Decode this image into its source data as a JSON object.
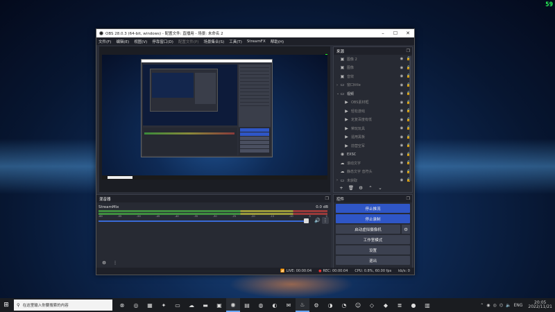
{
  "desktop": {
    "fps": "59"
  },
  "window": {
    "title": "OBS 28.0.3 (64-bit, windows) - 配置文件: 直播用 - 场景: 未命名 2",
    "min": "–",
    "max": "☐",
    "close": "✕"
  },
  "menu": [
    {
      "label": "文件(F)",
      "dim": false
    },
    {
      "label": "编辑(E)",
      "dim": false
    },
    {
      "label": "视图(V)",
      "dim": false
    },
    {
      "label": "停靠窗口(D)",
      "dim": false
    },
    {
      "label": "配置文件(P)",
      "dim": true
    },
    {
      "label": "场景集合(S)",
      "dim": false
    },
    {
      "label": "工具(T)",
      "dim": false
    },
    {
      "label": "StreamFX",
      "dim": false
    },
    {
      "label": "帮助(H)",
      "dim": false
    }
  ],
  "sources": {
    "title": "来源",
    "items": [
      {
        "label": "图像 2",
        "icon": "▣",
        "icon_name": "image-icon",
        "child": false,
        "chev": "",
        "dim": true
      },
      {
        "label": "图像",
        "icon": "▣",
        "icon_name": "image-icon",
        "child": false,
        "chev": "",
        "dim": true
      },
      {
        "label": "音效",
        "icon": "▣",
        "icon_name": "image-icon",
        "child": false,
        "chev": "",
        "dim": true
      },
      {
        "label": "窗口title",
        "icon": "▭",
        "icon_name": "folder-icon",
        "child": false,
        "chev": "›",
        "dim": true
      },
      {
        "label": "视频",
        "icon": "▭",
        "icon_name": "folder-icon",
        "child": false,
        "chev": "⌄",
        "dim": false
      },
      {
        "label": "OBS素材框",
        "icon": "▶",
        "icon_name": "media-icon",
        "child": true,
        "chev": "",
        "dim": true
      },
      {
        "label": "轻松游戏",
        "icon": "▶",
        "icon_name": "media-icon",
        "child": true,
        "chev": "",
        "dim": true
      },
      {
        "label": "定复百度有低",
        "icon": "▶",
        "icon_name": "media-icon",
        "child": true,
        "chev": "",
        "dim": true
      },
      {
        "label": "荣玩玩具",
        "icon": "▶",
        "icon_name": "media-icon",
        "child": true,
        "chev": "",
        "dim": true
      },
      {
        "label": "遥用黑板",
        "icon": "▶",
        "icon_name": "media-icon",
        "child": true,
        "chev": "",
        "dim": true
      },
      {
        "label": "前营空军",
        "icon": "▶",
        "icon_name": "media-icon",
        "child": true,
        "chev": "",
        "dim": true
      },
      {
        "label": "EXSC",
        "icon": "◉",
        "icon_name": "capture-icon",
        "child": false,
        "chev": "",
        "dim": false
      },
      {
        "label": "滚动文字",
        "icon": "☁",
        "icon_name": "cloud-icon",
        "child": false,
        "chev": "",
        "dim": true
      },
      {
        "label": "静态文字 音符头",
        "icon": "☁",
        "icon_name": "cloud-icon",
        "child": false,
        "chev": "",
        "dim": true
      },
      {
        "label": "未获取",
        "icon": "▭",
        "icon_name": "folder-icon",
        "child": false,
        "chev": "›",
        "dim": true
      }
    ],
    "toolbar": [
      "+",
      "🗑",
      "⚙",
      "⌃",
      "⌄"
    ]
  },
  "mixer": {
    "title": "混音器",
    "track": "StreamMix",
    "db": "0.0 dB",
    "ticks": [
      "-60",
      "-55",
      "-50",
      "-45",
      "-40",
      "-35",
      "-30",
      "-25",
      "-20",
      "-15",
      "-10",
      "-5",
      "0"
    ],
    "level": 0.98
  },
  "controls": {
    "title": "控件",
    "stop_stream": "停止推流",
    "stop_record": "停止录制",
    "virtual_cam": "启动虚拟摄像机",
    "studio_mode": "工作室模式",
    "settings": "设置",
    "exit": "退出"
  },
  "status": {
    "live": "LIVE: 00:00:04",
    "rec": "REC: 00:00:04",
    "cpu": "CPU: 0.8%, 60.00 fps",
    "kbps": "kb/s: 0"
  },
  "taskbar": {
    "search_placeholder": "在这里输入你要搜索的内容",
    "time": "20:05",
    "date": "2022/11/21",
    "lang": "ENG"
  }
}
